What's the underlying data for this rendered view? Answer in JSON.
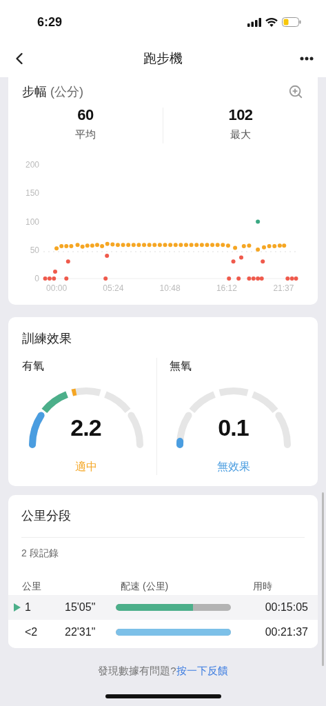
{
  "status_bar": {
    "time": "6:29"
  },
  "nav": {
    "title": "跑步機"
  },
  "stride": {
    "title": "步幅",
    "unit": "(公分)",
    "stats": [
      {
        "value": "60",
        "label": "平均"
      },
      {
        "value": "102",
        "label": "最大"
      }
    ],
    "chart_data": {
      "type": "scatter",
      "xlim": [
        -75,
        1370
      ],
      "ylim": [
        0,
        200
      ],
      "yticks": [
        0,
        50,
        100,
        150,
        200
      ],
      "xticks": [
        {
          "value": 0,
          "label": "00:00"
        },
        {
          "value": 324,
          "label": "05:24"
        },
        {
          "value": 648,
          "label": "10:48"
        },
        {
          "value": 972,
          "label": "16:12"
        },
        {
          "value": 1297,
          "label": "21:37"
        }
      ],
      "x": [
        -65,
        -40,
        -15,
        -8,
        0,
        28,
        56,
        66,
        84,
        120,
        148,
        176,
        204,
        232,
        260,
        280,
        288,
        290,
        320,
        350,
        380,
        410,
        440,
        470,
        500,
        530,
        560,
        590,
        620,
        650,
        680,
        710,
        740,
        770,
        800,
        830,
        860,
        890,
        920,
        950,
        980,
        985,
        1010,
        1020,
        1040,
        1055,
        1070,
        1100,
        1125,
        1150,
        1172,
        1178,
        1185,
        1215,
        1245,
        1275,
        1300,
        1320,
        1345,
        1368
      ],
      "series": [
        {
          "color": "#f5a623",
          "values": [
            null,
            null,
            null,
            null,
            53,
            57,
            57,
            null,
            57,
            59,
            56,
            58,
            58,
            59,
            57,
            null,
            null,
            61,
            60,
            59,
            59,
            59,
            59,
            59,
            59,
            59,
            59,
            59,
            59,
            59,
            59,
            59,
            59,
            59,
            59,
            59,
            59,
            59,
            59,
            59,
            58,
            null,
            null,
            54,
            null,
            null,
            57,
            58,
            null,
            51,
            null,
            null,
            55,
            57,
            57,
            58,
            58,
            null,
            null,
            null
          ]
        },
        {
          "color": "#ef5a4c",
          "values": [
            0,
            0,
            0,
            12,
            null,
            null,
            0,
            30,
            null,
            null,
            null,
            null,
            null,
            null,
            null,
            0,
            40,
            null,
            null,
            null,
            null,
            null,
            null,
            null,
            null,
            null,
            null,
            null,
            null,
            null,
            null,
            null,
            null,
            null,
            null,
            null,
            null,
            null,
            null,
            null,
            null,
            0,
            30,
            null,
            0,
            37,
            null,
            0,
            0,
            0,
            0,
            30,
            null,
            null,
            null,
            null,
            null,
            0,
            0,
            0
          ]
        },
        {
          "color": "#3aa883",
          "values": [
            null,
            null,
            null,
            null,
            null,
            null,
            null,
            null,
            null,
            null,
            null,
            null,
            null,
            null,
            null,
            null,
            null,
            null,
            null,
            null,
            null,
            null,
            null,
            null,
            null,
            null,
            null,
            null,
            null,
            null,
            null,
            null,
            null,
            null,
            null,
            null,
            null,
            null,
            null,
            null,
            null,
            null,
            null,
            null,
            null,
            null,
            null,
            null,
            null,
            100,
            null,
            null,
            null,
            null,
            null,
            null,
            null,
            null,
            null,
            null
          ]
        }
      ]
    }
  },
  "training_effect": {
    "title": "訓練效果",
    "gauges": [
      {
        "label": "有氧",
        "value": "2.2",
        "rating": "適中",
        "color": "#f5a623"
      },
      {
        "label": "無氧",
        "value": "0.1",
        "rating": "無效果",
        "color": "#4a9de0"
      }
    ]
  },
  "splits": {
    "title": "公里分段",
    "count": "2 段記錄",
    "columns": [
      "公里",
      "配速 (公里)",
      "用時"
    ],
    "rows": [
      {
        "km": "1",
        "pace": "15'05\"",
        "level": 0.67,
        "color": "#4caf8a",
        "time": "00:15:05",
        "selected": true
      },
      {
        "km": "<2",
        "pace": "22'31\"",
        "level": 1,
        "color": "#7cc0e8",
        "time": "00:21:37",
        "selected": false
      }
    ]
  },
  "feedback": {
    "text": "發現數據有問題?",
    "link": "按一下反饋"
  }
}
